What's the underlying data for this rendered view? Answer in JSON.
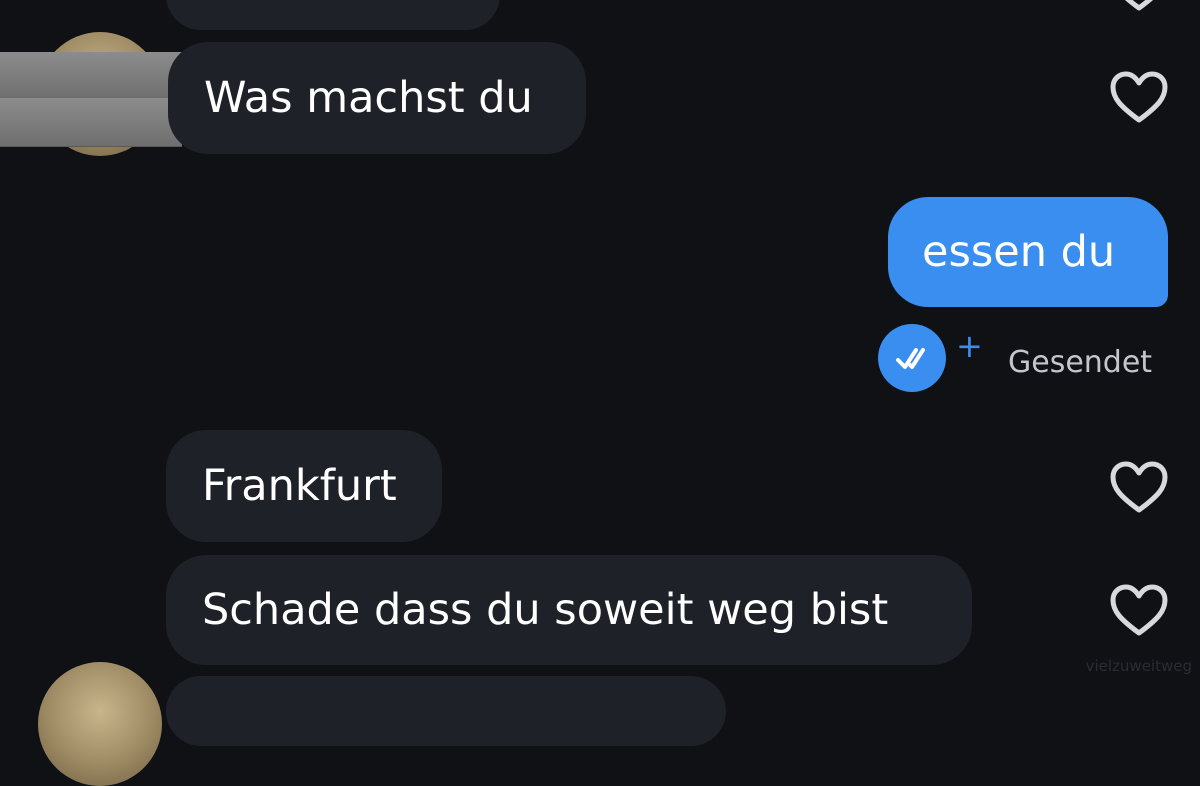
{
  "theme": {
    "background": "#0f1115",
    "received_bubble": "#1f2128",
    "sent_bubble": "#3a8ef0",
    "accent": "#3a8ef0",
    "icon_gray": "#d8d9dd"
  },
  "messages": [
    {
      "direction": "received",
      "text": "Was machst du",
      "liked": false
    },
    {
      "direction": "sent",
      "text": "essen du"
    },
    {
      "direction": "received",
      "text": "Frankfurt",
      "liked": false
    },
    {
      "direction": "received",
      "text": "Schade dass du soweit weg bist",
      "liked": false
    }
  ],
  "sent_status": {
    "label": "Gesendet",
    "plus": "+",
    "icon": "double-check-icon"
  },
  "icons": {
    "like": "heart-outline-icon",
    "avatar": "avatar"
  },
  "watermark": "vielzuweitweg"
}
